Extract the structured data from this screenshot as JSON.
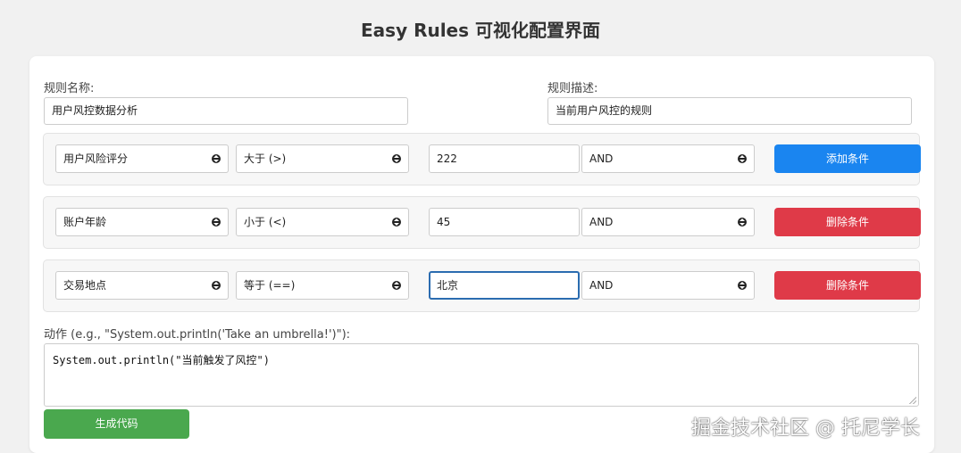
{
  "page": {
    "title": "Easy Rules 可视化配置界面"
  },
  "rule": {
    "name_label": "规则名称:",
    "name_value": "用户风控数据分析",
    "desc_label": "规则描述:",
    "desc_value": "当前用户风控的规则"
  },
  "conditions": [
    {
      "field": "用户风险评分",
      "operator": "大于 (>)",
      "value": "222",
      "logic": "AND",
      "button": "添加条件",
      "button_type": "add"
    },
    {
      "field": "账户年龄",
      "operator": "小于 (<)",
      "value": "45",
      "logic": "AND",
      "button": "删除条件",
      "button_type": "delete"
    },
    {
      "field": "交易地点",
      "operator": "等于 (==)",
      "value": "北京",
      "logic": "AND",
      "button": "删除条件",
      "button_type": "delete"
    }
  ],
  "action": {
    "label": "动作 (e.g., \"System.out.println('Take an umbrella!')\"):",
    "value": "System.out.println(\"当前触发了风控\")"
  },
  "generate_button": "生成代码",
  "watermark": "掘金技术社区 @ 托尼学长",
  "colors": {
    "add": "#1a85f0",
    "delete": "#df3a48",
    "generate": "#4aa84e",
    "focus": "#2b6cb0"
  }
}
